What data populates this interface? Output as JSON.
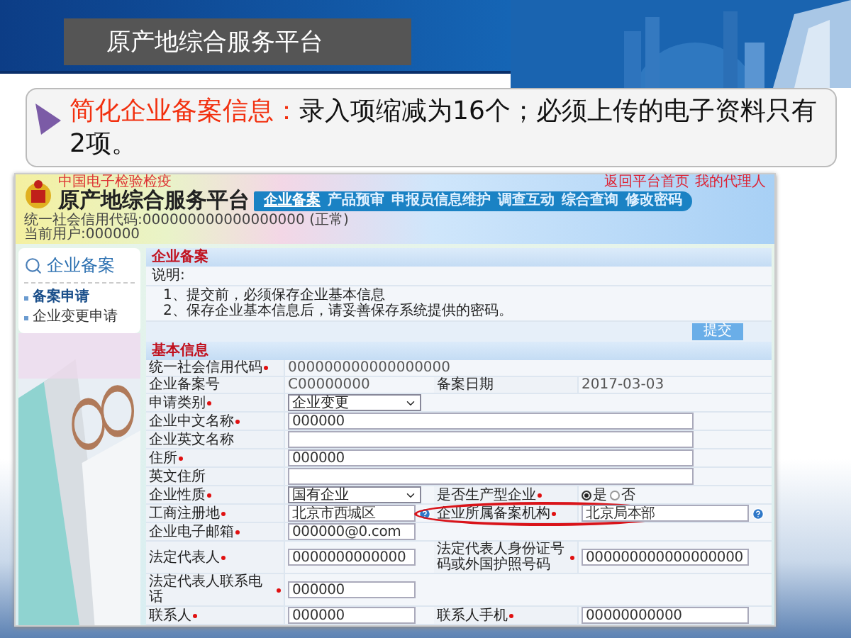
{
  "slide": {
    "title": "原产地综合服务平台",
    "callout": {
      "heading": "简化企业备案信息：",
      "text": "录入项缩减为16个；必须上传的电子资料只有2项。"
    }
  },
  "app": {
    "brand": {
      "tagline": "中国电子检验检疫",
      "title": "原产地综合服务平台"
    },
    "nav": [
      {
        "label": "企业备案",
        "selected": true
      },
      {
        "label": "产品预审",
        "selected": false
      },
      {
        "label": "申报员信息维护",
        "selected": false
      },
      {
        "label": "调查互动",
        "selected": false
      },
      {
        "label": "综合查询",
        "selected": false
      },
      {
        "label": "修改密码",
        "selected": false
      }
    ],
    "top_links": [
      "返回平台首页",
      "我的代理人"
    ],
    "account": {
      "credit_code": "统一社会信用代码:000000000000000000 (正常)",
      "user": "当前用户:000000"
    },
    "sidebar": {
      "heading": "企业备案",
      "items": [
        {
          "label": "备案申请",
          "selected": true
        },
        {
          "label": "企业变更申请",
          "selected": false
        }
      ]
    },
    "notice": {
      "title": "企业备案",
      "label": "说明:",
      "lines": [
        "1、提交前，必须保存企业基本信息",
        "2、保存企业基本信息后，请妥善保存系统提供的密码。"
      ],
      "button": "提交"
    },
    "form": {
      "title": "基本信息",
      "rows": [
        {
          "fields": [
            {
              "label": "统一社会信用代码",
              "required": true,
              "kind": "static",
              "value": "000000000000000000"
            }
          ]
        },
        {
          "fields": [
            {
              "label": "企业备案号",
              "required": false,
              "kind": "static",
              "value": "C00000000"
            },
            {
              "label": "备案日期",
              "required": false,
              "kind": "static",
              "value": "2017-03-03"
            }
          ]
        },
        {
          "fields": [
            {
              "label": "申请类别",
              "required": true,
              "kind": "select",
              "value": "企业变更"
            }
          ]
        },
        {
          "fields": [
            {
              "label": "企业中文名称",
              "required": true,
              "kind": "wide",
              "value": "000000"
            }
          ]
        },
        {
          "fields": [
            {
              "label": "企业英文名称",
              "required": false,
              "kind": "wide"
            }
          ]
        },
        {
          "fields": [
            {
              "label": "住所",
              "required": true,
              "kind": "wide",
              "value": "000000"
            }
          ]
        },
        {
          "fields": [
            {
              "label": "英文住所",
              "required": false,
              "kind": "wide"
            }
          ]
        },
        {
          "fields": [
            {
              "label": "企业性质",
              "required": true,
              "kind": "select",
              "value": "国有企业"
            },
            {
              "label": "是否生产型企业",
              "required": true,
              "kind": "radio",
              "options": [
                {
                  "label": "是",
                  "selected": true
                },
                {
                  "label": "否",
                  "selected": false
                }
              ]
            }
          ]
        },
        {
          "fields": [
            {
              "label": "工商注册地",
              "required": true,
              "kind": "input",
              "value": "北京市西城区",
              "help": true
            },
            {
              "label": "企业所属备案机构",
              "required": true,
              "kind": "input",
              "value": "北京局本部",
              "help": true,
              "highlighted": true
            }
          ]
        },
        {
          "fields": [
            {
              "label": "企业电子邮箱",
              "required": true,
              "kind": "input",
              "value": "000000@0.com"
            }
          ]
        },
        {
          "fields": [
            {
              "label": "法定代表人",
              "required": true,
              "kind": "input",
              "value": "0000000000000"
            },
            {
              "label": "法定代表人身份证号码或外国护照号码",
              "required": true,
              "kind": "input",
              "value": "000000000000000000"
            }
          ]
        },
        {
          "fields": [
            {
              "label": "法定代表人联系电话",
              "required": true,
              "kind": "input",
              "value": "000000"
            }
          ]
        },
        {
          "fields": [
            {
              "label": "联系人",
              "required": true,
              "kind": "input",
              "value": "000000"
            },
            {
              "label": "联系人手机",
              "required": true,
              "kind": "input",
              "value": "00000000000"
            }
          ]
        }
      ]
    }
  }
}
